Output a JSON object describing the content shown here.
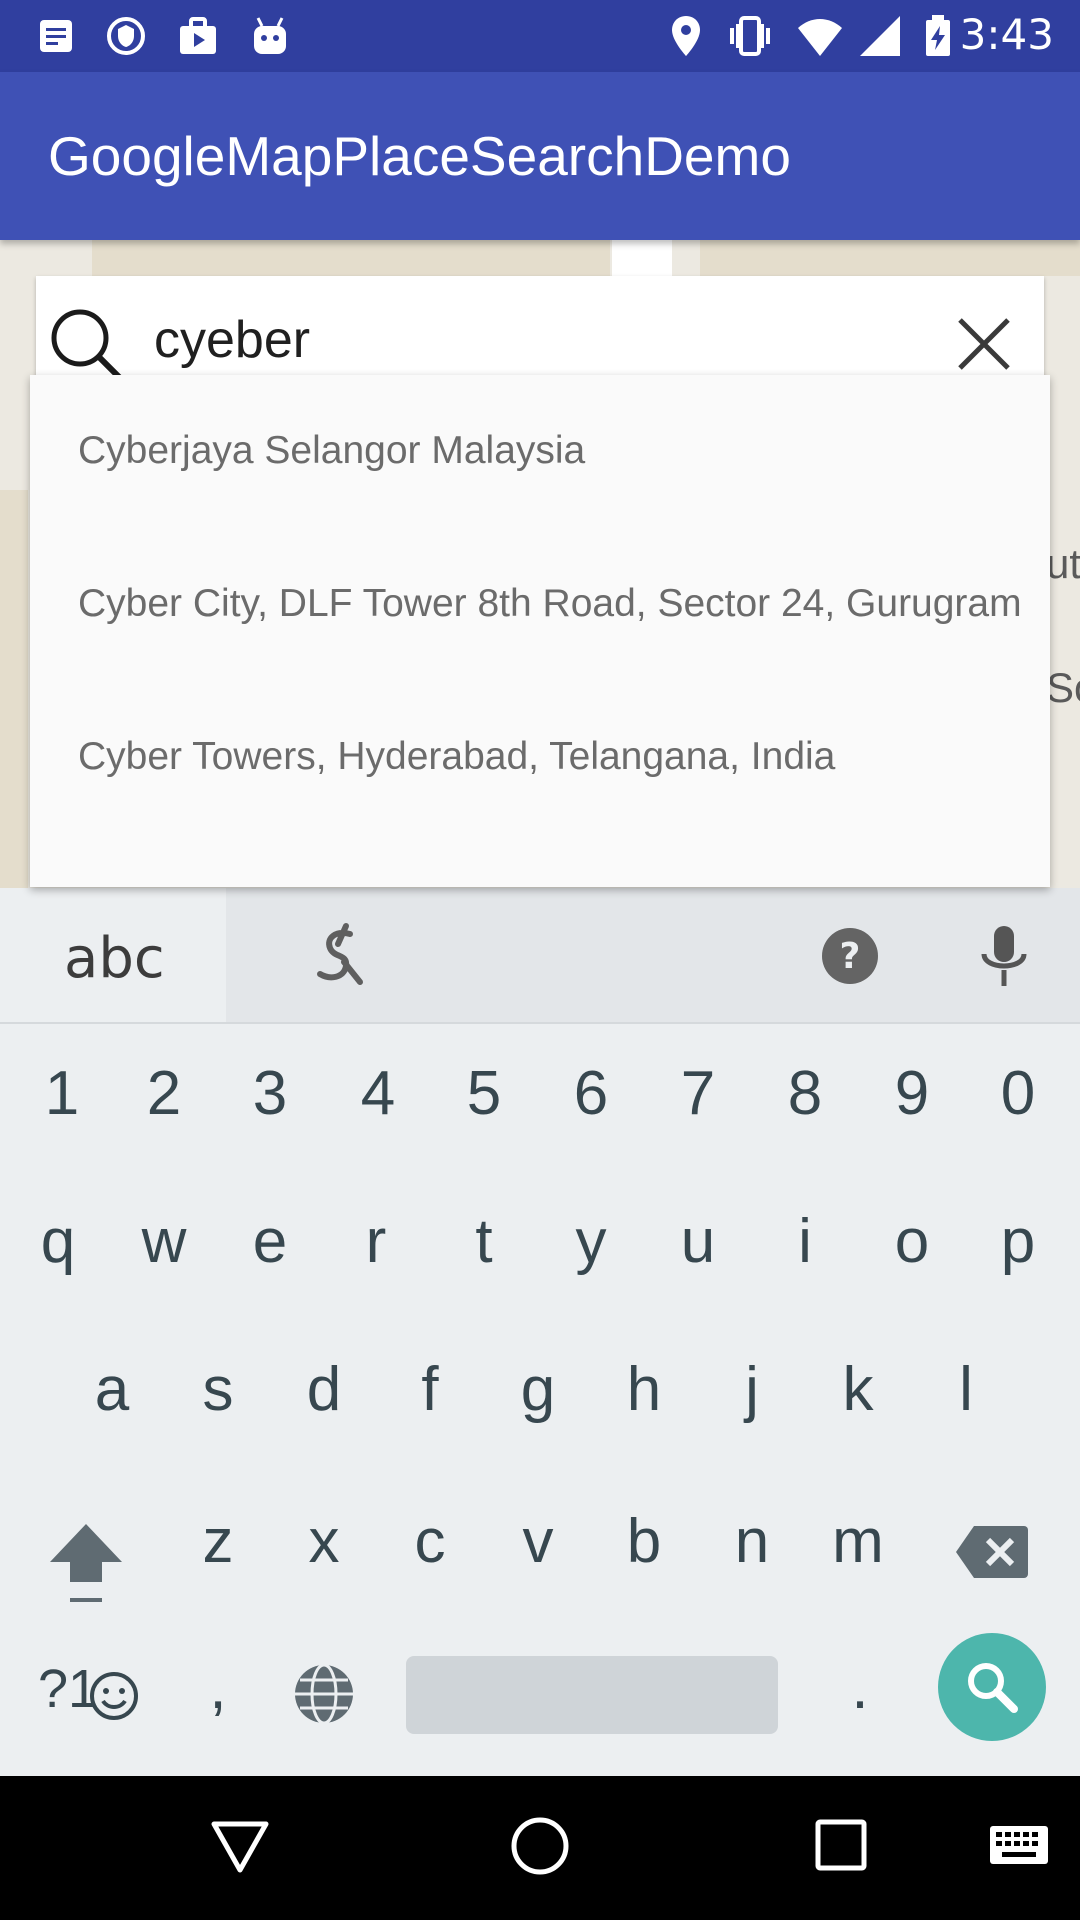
{
  "status_bar": {
    "time": "3:43",
    "left_icons": [
      "notes-icon",
      "vpn-shield-icon",
      "briefcase-play-icon",
      "android-icon"
    ],
    "right_icons": [
      "location-icon",
      "vibrate-icon",
      "wifi-icon",
      "signal-icon",
      "battery-charging-icon"
    ]
  },
  "app_bar": {
    "title": "GoogleMapPlaceSearchDemo"
  },
  "map": {
    "fragments": [
      "uti",
      "So"
    ]
  },
  "search": {
    "query": "cyeber"
  },
  "suggestions": [
    "Cyberjaya Selangor Malaysia",
    "Cyber City, DLF Tower 8th Road, Sector 24, Gurugram",
    "Cyber Towers, Hyderabad, Telangana, India"
  ],
  "keyboard": {
    "mode_label": "abc",
    "number_row": [
      "1",
      "2",
      "3",
      "4",
      "5",
      "6",
      "7",
      "8",
      "9",
      "0"
    ],
    "row1": [
      "q",
      "w",
      "e",
      "r",
      "t",
      "y",
      "u",
      "i",
      "o",
      "p"
    ],
    "row2": [
      "a",
      "s",
      "d",
      "f",
      "g",
      "h",
      "j",
      "k",
      "l"
    ],
    "row3": [
      "z",
      "x",
      "c",
      "v",
      "b",
      "n",
      "m"
    ],
    "symbols_label": "?1",
    "comma": ",",
    "period": "."
  },
  "colors": {
    "status_bar": "#303f9f",
    "app_bar": "#3f51b5",
    "fab": "#4db6ac"
  }
}
